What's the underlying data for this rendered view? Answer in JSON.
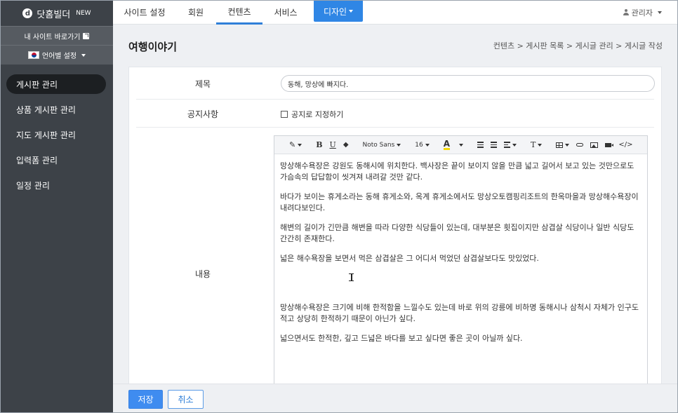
{
  "brand": {
    "logo_letter": "d",
    "name": "닷홈빌더",
    "suffix": "NEW"
  },
  "sidebar": {
    "site_shortcut": "내 사이트 바로가기",
    "language": "언어별 설정",
    "items": [
      {
        "label": "게시판 관리",
        "active": true
      },
      {
        "label": "상품 게시판 관리"
      },
      {
        "label": "지도 게시판 관리"
      },
      {
        "label": "입력폼 관리"
      },
      {
        "label": "일정 관리"
      }
    ]
  },
  "topnav": {
    "tabs": [
      {
        "label": "사이트 설정"
      },
      {
        "label": "회원"
      },
      {
        "label": "컨텐츠",
        "active": true
      },
      {
        "label": "서비스"
      },
      {
        "label": "디자인"
      }
    ],
    "user": "관리자"
  },
  "page": {
    "title": "여행이야기",
    "breadcrumb": "컨텐츠 > 게시판 목록 > 게시글 관리 > 게시글 작성"
  },
  "form": {
    "title_label": "제목",
    "title_value": "동해, 망상에 빠지다.",
    "notice_label": "공지사항",
    "notice_checkbox": "공지로 지정하기",
    "content_label": "내용"
  },
  "editor": {
    "toolbar": {
      "font": "Noto Sans",
      "size": "16",
      "highlight": "A",
      "text_style": "T",
      "code": "</>"
    },
    "paragraphs": [
      "망상해수욕장은 강원도 동해시에 위치한다. 백사장은 끝이 보이지 않을 만큼 넓고 길어서 보고 있는 것만으로도 가슴속의 답답함이 씻겨져 내려갈 것만 같다.",
      "바다가 보이는 휴게소라는 동해 휴게소와, 옥계 휴게소에서도 망상오토캠핑리조트의 한옥마을과 망상해수욕장이 내려다보인다.",
      "해변의 길이가 긴만큼 해변을 따라 다양한 식당들이 있는데, 대부분은 횟집이지만 삼겹살 식당이나 일반 식당도 간간히 존재한다.",
      "넓은 해수욕장을 보면서 먹은 삼겹살은 그 어디서 먹었던 삼겹살보다도 맛있었다.",
      "망상해수욕장은 크기에 비해 한적함을 느낄수도 있는데 바로 위의 강릉에 비하명 동해시나 삼척시 자체가 인구도 적고 상당히 한적하기 때문이 아닌가 싶다.",
      "넓으면서도 한적한, 깊고 드넓은 바다를 보고 싶다면 좋은 곳이 아닐까 싶다."
    ]
  },
  "footer": {
    "save": "저장",
    "cancel": "취소"
  },
  "colors": {
    "sidebar": "#3d4248",
    "accent": "#2f86e5",
    "highlight": "#f5d90a"
  }
}
